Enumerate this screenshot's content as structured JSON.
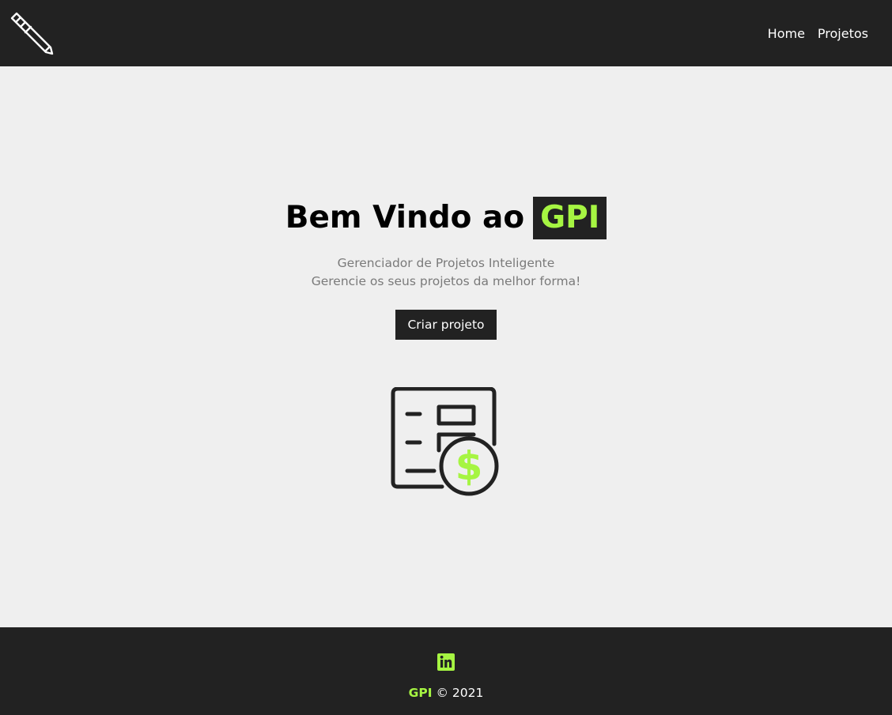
{
  "nav": {
    "logo_icon": "pen-icon",
    "links": [
      {
        "label": "Home"
      },
      {
        "label": "Projetos"
      }
    ]
  },
  "hero": {
    "title_prefix": "Bem Vindo ao",
    "title_brand": "GPI",
    "subtitle_line1": "Gerenciador de Projetos Inteligente",
    "subtitle_line2": "Gerencie os seus projetos da melhor forma!",
    "cta_label": "Criar projeto",
    "illustration_icon": "project-budget-icon"
  },
  "footer": {
    "social_icon": "linkedin-icon",
    "brand": "GPI",
    "copyright": "© 2021"
  },
  "colors": {
    "dark": "#222222",
    "accent": "#a6f542",
    "background": "#efefef",
    "muted_text": "#7a7a7a"
  }
}
